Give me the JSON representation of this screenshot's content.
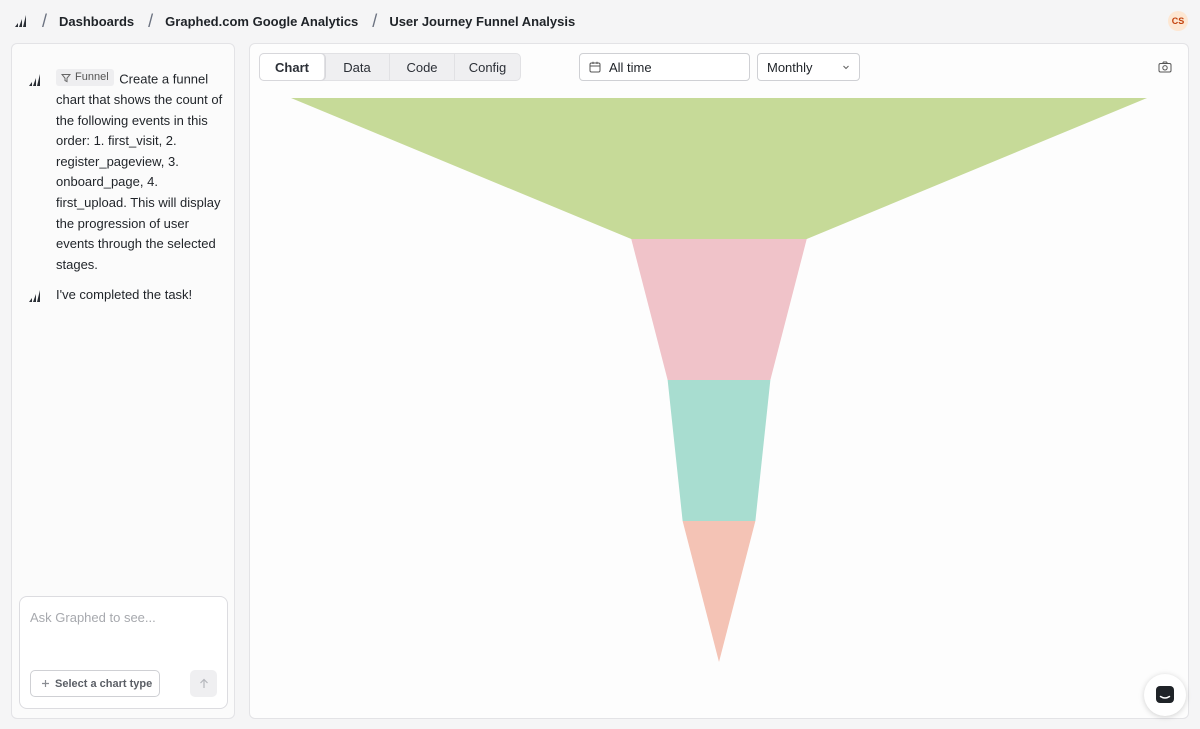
{
  "breadcrumb": {
    "items": [
      "Dashboards",
      "Graphed.com Google Analytics",
      "User Journey Funnel Analysis"
    ],
    "separator": "/"
  },
  "user": {
    "initials": "CS"
  },
  "chat": {
    "messages": [
      {
        "tag": "Funnel",
        "text": "Create a funnel chart that shows the count of the following events in this order: 1. first_visit, 2. register_pageview, 3. onboard_page, 4. first_upload. This will display the progression of user events through the selected stages."
      },
      {
        "text": "I've completed the task!"
      }
    ],
    "composer": {
      "placeholder": "Ask Graphed to see...",
      "chart_type_label": "Select a chart type"
    }
  },
  "toolbar": {
    "tabs": [
      "Chart",
      "Data",
      "Code",
      "Config"
    ],
    "active_tab": "Chart",
    "date_range": "All time",
    "period": "Monthly"
  },
  "chart_data": {
    "type": "funnel",
    "stages": [
      {
        "value": 1.0,
        "color": "#c6da98"
      },
      {
        "value": 0.205,
        "color": "#f0c3c9"
      },
      {
        "value": 0.12,
        "color": "#a8ddd0"
      },
      {
        "value": 0.085,
        "color": "#f4c3b5"
      }
    ]
  }
}
